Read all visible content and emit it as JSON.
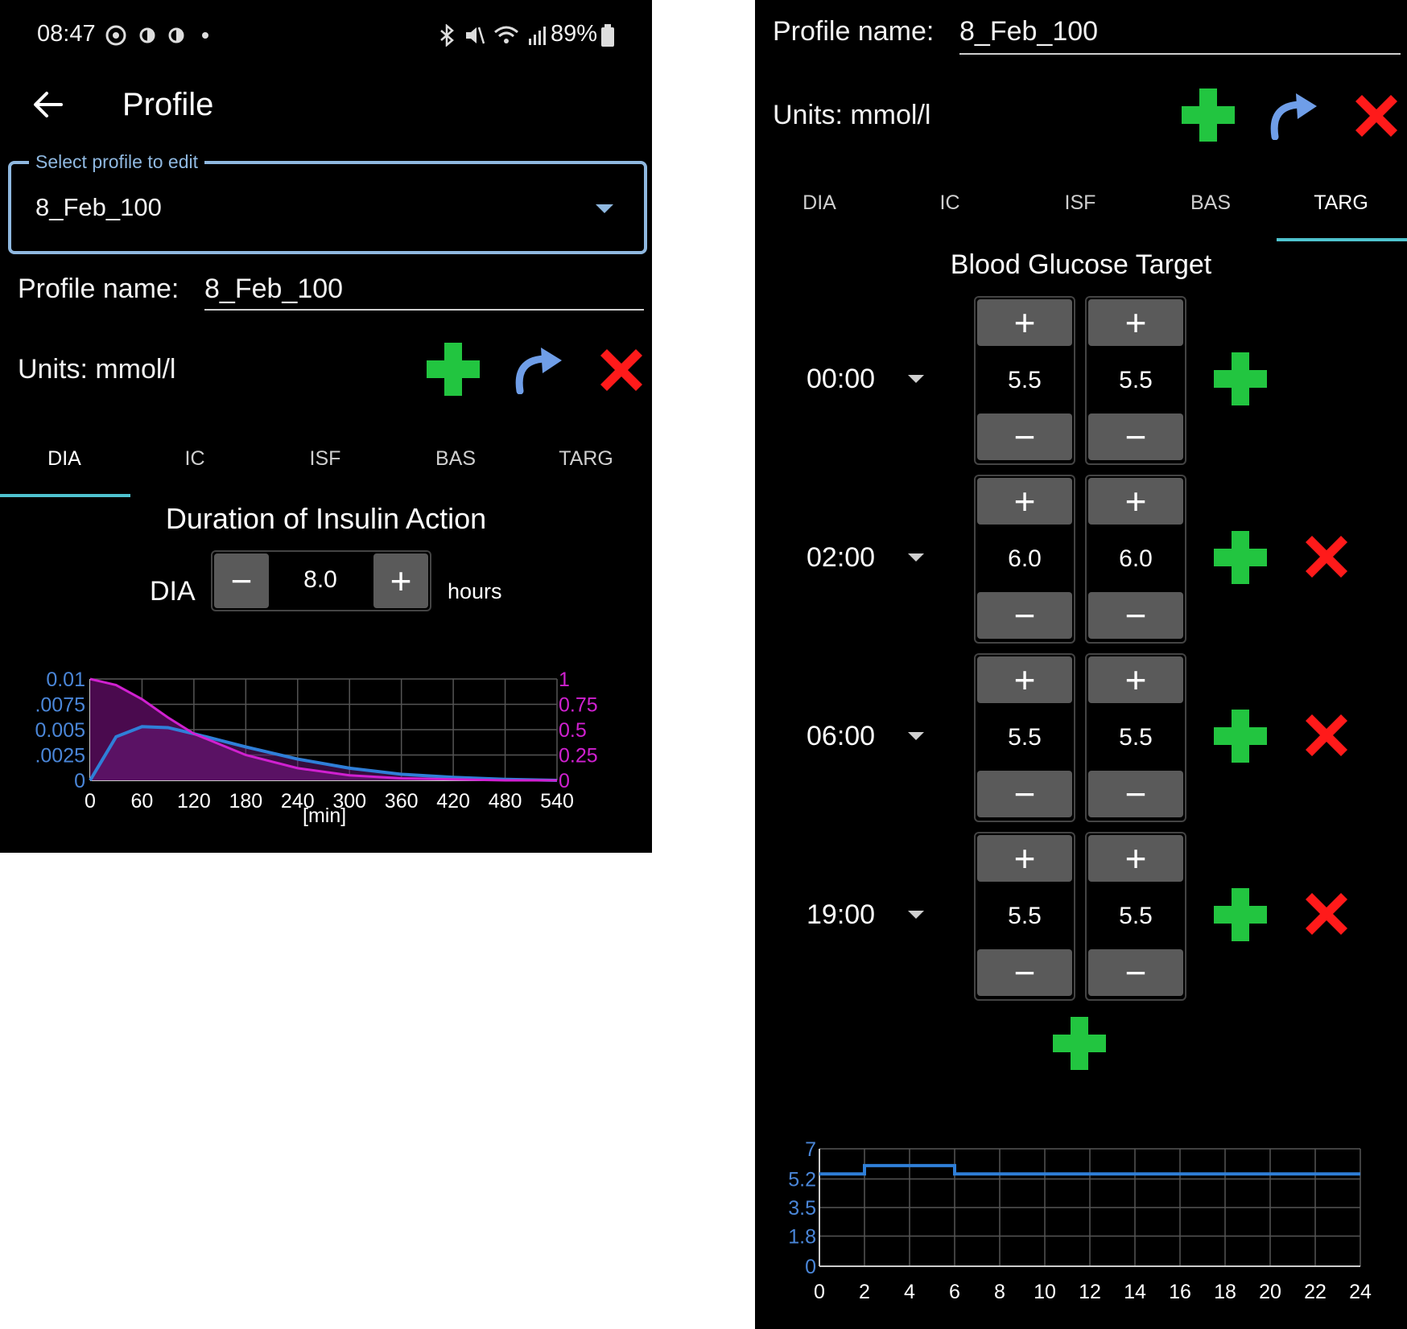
{
  "status_bar": {
    "time": "08:47",
    "battery": "89%"
  },
  "left": {
    "header": {
      "back_icon": "arrow-left-icon",
      "title": "Profile"
    },
    "select": {
      "legend": "Select profile to edit",
      "value": "8_Feb_100"
    },
    "profile_name": {
      "label": "Profile name:",
      "value": "8_Feb_100"
    },
    "units": {
      "label": "Units: mmol/l"
    },
    "tabs": [
      {
        "label": "DIA",
        "active": true
      },
      {
        "label": "IC",
        "active": false
      },
      {
        "label": "ISF",
        "active": false
      },
      {
        "label": "BAS",
        "active": false
      },
      {
        "label": "TARG",
        "active": false
      }
    ],
    "dia": {
      "heading": "Duration of Insulin Action",
      "label": "DIA",
      "value": "8.0",
      "unit": "hours",
      "minus": "−",
      "plus": "+"
    }
  },
  "right": {
    "profile_name": {
      "label": "Profile name:",
      "value": "8_Feb_100"
    },
    "units": {
      "label": "Units: mmol/l"
    },
    "tabs": [
      {
        "label": "DIA",
        "active": false
      },
      {
        "label": "IC",
        "active": false
      },
      {
        "label": "ISF",
        "active": false
      },
      {
        "label": "BAS",
        "active": false
      },
      {
        "label": "TARG",
        "active": true
      }
    ],
    "targ": {
      "heading": "Blood Glucose Target",
      "rows": [
        {
          "time": "00:00",
          "low": "5.5",
          "high": "5.5",
          "deletable": false
        },
        {
          "time": "02:00",
          "low": "6.0",
          "high": "6.0",
          "deletable": true
        },
        {
          "time": "06:00",
          "low": "5.5",
          "high": "5.5",
          "deletable": true
        },
        {
          "time": "19:00",
          "low": "5.5",
          "high": "5.5",
          "deletable": true
        }
      ],
      "plus": "+",
      "minus": "−"
    }
  },
  "colors": {
    "green": "#22c540",
    "red": "#ff1a1a",
    "blue_arrow": "#6f9ee8",
    "tab_indicator": "#4fc3cf",
    "chart_blue": "#2f7fd8",
    "chart_magenta": "#d020d0"
  },
  "chart_data": [
    {
      "type": "area",
      "xlabel": "[min]",
      "x_ticks": [
        "0",
        "60",
        "120",
        "180",
        "240",
        "300",
        "360",
        "420",
        "480",
        "540"
      ],
      "y_left_ticks": [
        "0",
        "0.0025",
        "0.005",
        "0.0075",
        "0.01"
      ],
      "y_left_tick_labels": [
        "0",
        ".0025",
        "0.005",
        ".0075",
        "0.01"
      ],
      "y_right_ticks": [
        "0",
        "0.25",
        "0.5",
        "0.75",
        "1"
      ],
      "xlim": [
        0,
        540
      ],
      "ylim_left": [
        0,
        0.01
      ],
      "ylim_right": [
        0,
        1
      ],
      "grid": true,
      "series": [
        {
          "color": "#2f7fd8",
          "axis": "left",
          "x": [
            0,
            30,
            60,
            90,
            120,
            180,
            240,
            300,
            360,
            420,
            480,
            540
          ],
          "y": [
            0,
            0.0043,
            0.0053,
            0.0052,
            0.0046,
            0.0033,
            0.0021,
            0.0012,
            0.0006,
            0.0003,
            0.0001,
            0
          ]
        },
        {
          "color": "#d020d0",
          "axis": "right",
          "x": [
            0,
            30,
            60,
            90,
            120,
            180,
            240,
            300,
            360,
            420,
            480,
            540
          ],
          "y": [
            1,
            0.94,
            0.8,
            0.62,
            0.46,
            0.25,
            0.12,
            0.05,
            0.02,
            0.01,
            0,
            0
          ]
        }
      ]
    },
    {
      "type": "line",
      "x_ticks": [
        "0",
        "2",
        "4",
        "6",
        "8",
        "10",
        "12",
        "14",
        "16",
        "18",
        "20",
        "22",
        "24"
      ],
      "y_ticks": [
        "0",
        "1.8",
        "3.5",
        "5.2",
        "7"
      ],
      "xlim": [
        0,
        24
      ],
      "ylim": [
        0,
        7
      ],
      "grid": true,
      "series": [
        {
          "color": "#2f7fd8",
          "x": [
            0,
            2,
            2,
            6,
            6,
            19,
            19,
            24
          ],
          "y": [
            5.5,
            5.5,
            6.0,
            6.0,
            5.5,
            5.5,
            5.5,
            5.5
          ]
        }
      ]
    }
  ]
}
